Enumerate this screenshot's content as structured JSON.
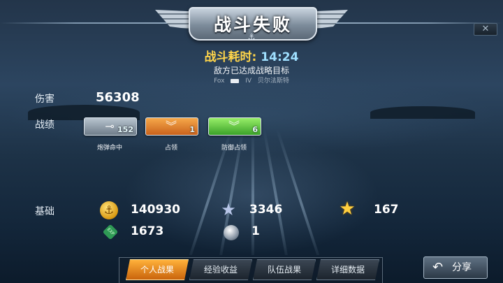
{
  "header": {
    "title": "战斗失败",
    "close_glyph": "✕"
  },
  "battle": {
    "time_label": "战斗耗时:",
    "time_value": "14:24",
    "message": "敌方已达成战略目标",
    "commander": "Fox",
    "tier": "IV",
    "ship": "贝尔法斯特"
  },
  "damage": {
    "label": "伤害",
    "value": "56308"
  },
  "achievements": {
    "label": "战绩",
    "items": [
      {
        "icon": "shell-icon",
        "count": "152",
        "caption": "炮弹命中",
        "color": "gray"
      },
      {
        "icon": "chevron-icon",
        "count": "1",
        "caption": "占领",
        "color": "orange"
      },
      {
        "icon": "chevron-icon",
        "count": "6",
        "caption": "防御占领",
        "color": "green"
      }
    ]
  },
  "base": {
    "label": "基础",
    "coins": "140930",
    "silver_star": "3346",
    "gold_star": "167",
    "exp": "1673",
    "orb": "1"
  },
  "tabs": [
    {
      "label": "个人战果",
      "active": true
    },
    {
      "label": "经验收益",
      "active": false
    },
    {
      "label": "队伍战果",
      "active": false
    },
    {
      "label": "详细数据",
      "active": false
    }
  ],
  "share": {
    "label": "分享"
  },
  "colors": {
    "accent_gold": "#ffd54a",
    "accent_blue": "#9fe0ff",
    "tab_active": "#f08a22"
  }
}
